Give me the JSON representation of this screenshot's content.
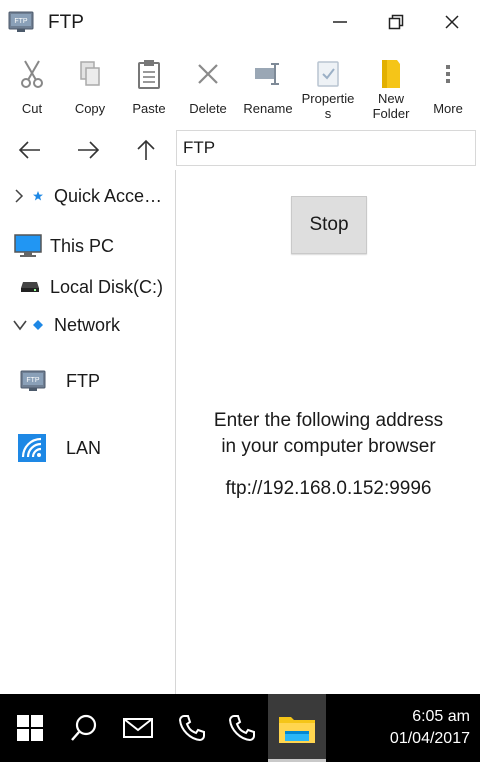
{
  "window": {
    "title": "FTP",
    "icon_label": "FTP"
  },
  "toolbar": {
    "items": [
      {
        "label": "Cut",
        "icon": "scissors-icon"
      },
      {
        "label": "Copy",
        "icon": "copy-icon"
      },
      {
        "label": "Paste",
        "icon": "clipboard-icon"
      },
      {
        "label": "Delete",
        "icon": "x-icon"
      },
      {
        "label": "Rename",
        "icon": "rename-icon"
      },
      {
        "label": "Properties",
        "icon": "properties-icon"
      },
      {
        "label": "New Folder",
        "icon": "folder-icon"
      },
      {
        "label": "More",
        "icon": "more-vertical-icon"
      }
    ],
    "properties_line1": "Propertie",
    "properties_line2": "s",
    "newfolder_line1": "New",
    "newfolder_line2": "Folder"
  },
  "address_bar": {
    "path": "FTP"
  },
  "sidebar": {
    "items": [
      {
        "label": "Quick Acce…",
        "icon": "star-icon",
        "expander": "collapsed"
      },
      {
        "label": "This PC",
        "icon": "monitor-icon"
      },
      {
        "label": "Local Disk(C:)",
        "icon": "drive-icon"
      },
      {
        "label": "Network",
        "icon": "network-icon",
        "expander": "expanded"
      },
      {
        "label": "FTP",
        "icon": "ftp-icon"
      },
      {
        "label": "LAN",
        "icon": "wifi-icon"
      }
    ]
  },
  "main": {
    "stop_label": "Stop",
    "message_line1": "Enter the following address",
    "message_line2": "in your computer browser",
    "ftp_url": "ftp://192.168.0.152:9996"
  },
  "taskbar": {
    "time": "6:05 am",
    "date": "01/04/2017"
  },
  "colors": {
    "accent_blue": "#1e88e5",
    "folder_yellow": "#f5c518",
    "taskbar_bg": "#000000"
  }
}
